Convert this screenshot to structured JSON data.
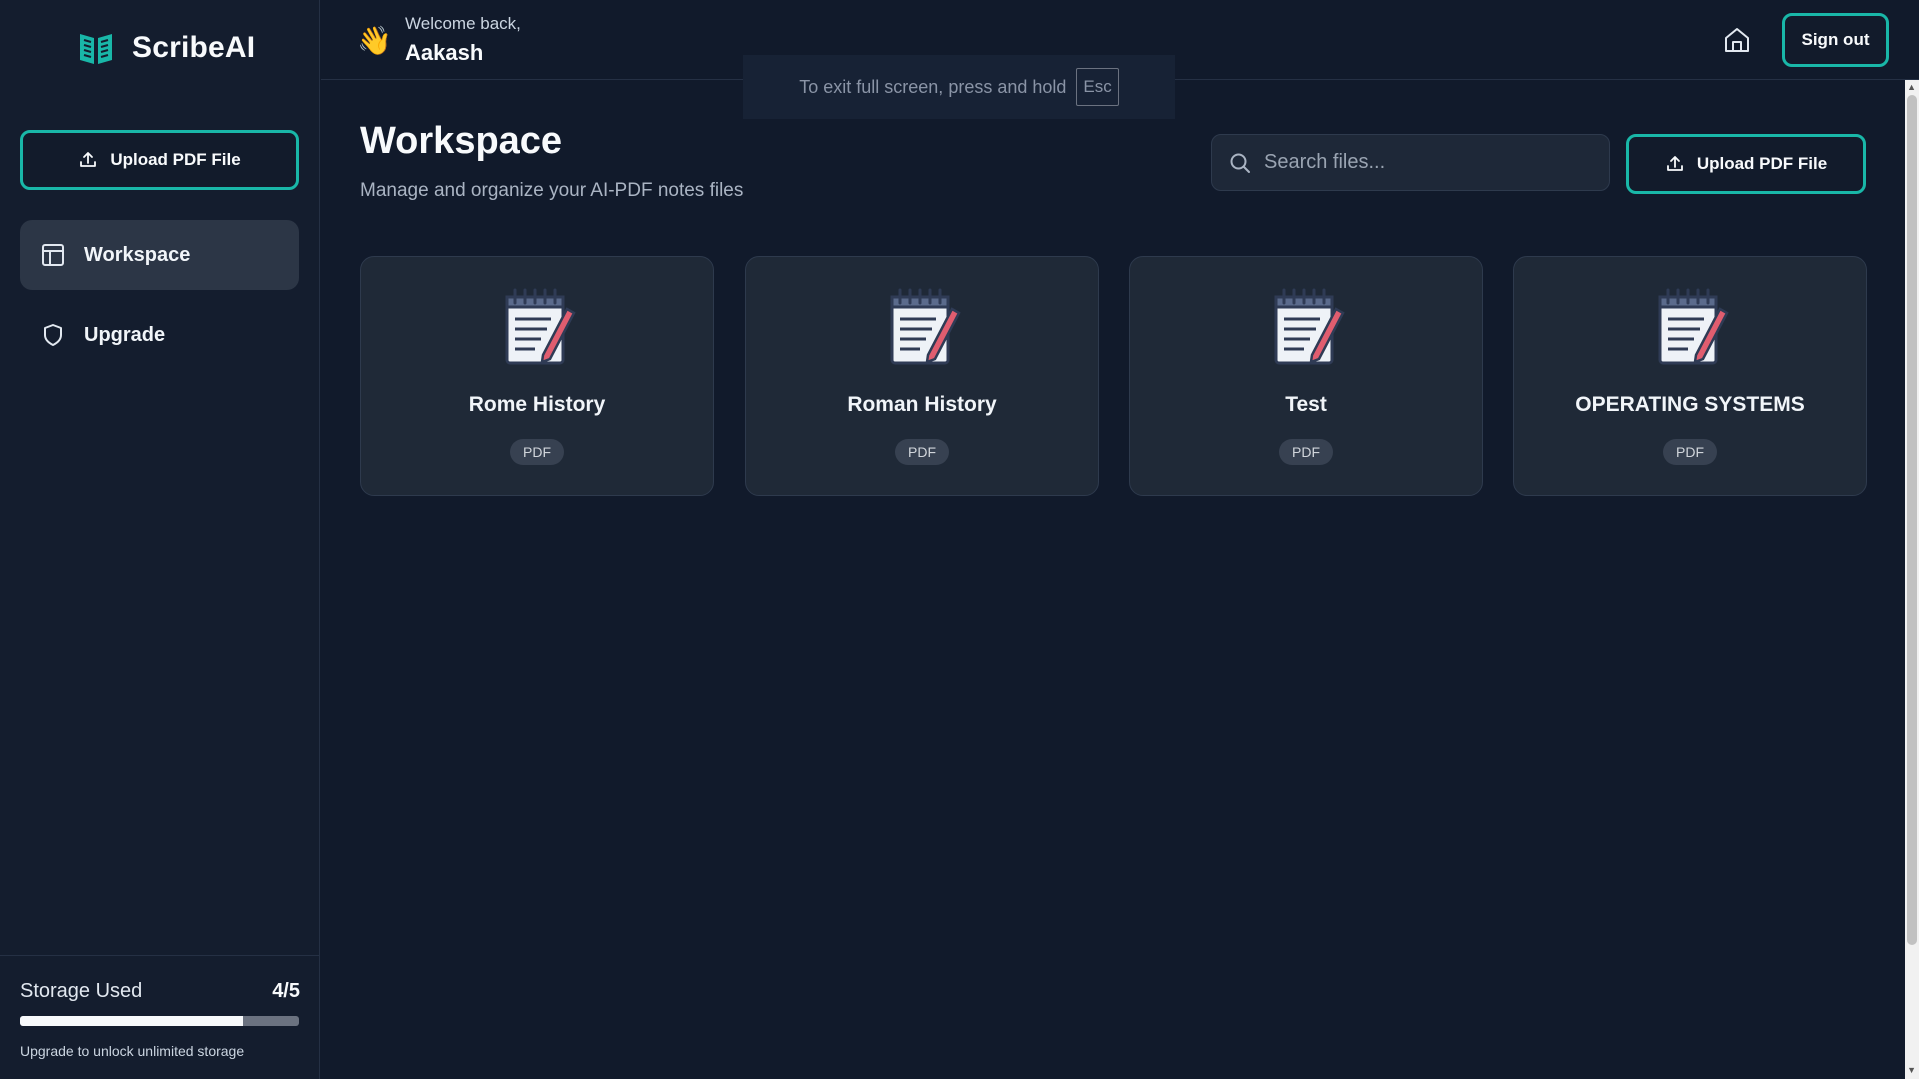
{
  "brand": {
    "name": "ScribeAI",
    "accent": "#19b7a8"
  },
  "sidebar": {
    "upload_label": "Upload PDF File",
    "items": [
      {
        "label": "Workspace",
        "icon": "layout-icon",
        "active": true
      },
      {
        "label": "Upgrade",
        "icon": "shield-icon",
        "active": false
      }
    ],
    "storage": {
      "label": "Storage Used",
      "count": "4/5",
      "used_fraction": 0.8,
      "note": "Upgrade to unlock unlimited storage"
    }
  },
  "header": {
    "wave_icon": "👋",
    "welcome": "Welcome back,",
    "user_name": "Aakash",
    "signout_label": "Sign out",
    "home_icon": "home-icon"
  },
  "fullscreen_toast": {
    "text": "To exit full screen, press and hold",
    "key": "Esc"
  },
  "main": {
    "title": "Workspace",
    "subtitle": "Manage and organize your AI-PDF notes files",
    "search": {
      "placeholder": "Search files...",
      "value": ""
    },
    "upload_label": "Upload PDF File",
    "files": [
      {
        "name": "Rome History",
        "type": "PDF"
      },
      {
        "name": "Roman History",
        "type": "PDF"
      },
      {
        "name": "Test",
        "type": "PDF"
      },
      {
        "name": "OPERATING SYSTEMS",
        "type": "PDF"
      }
    ]
  }
}
